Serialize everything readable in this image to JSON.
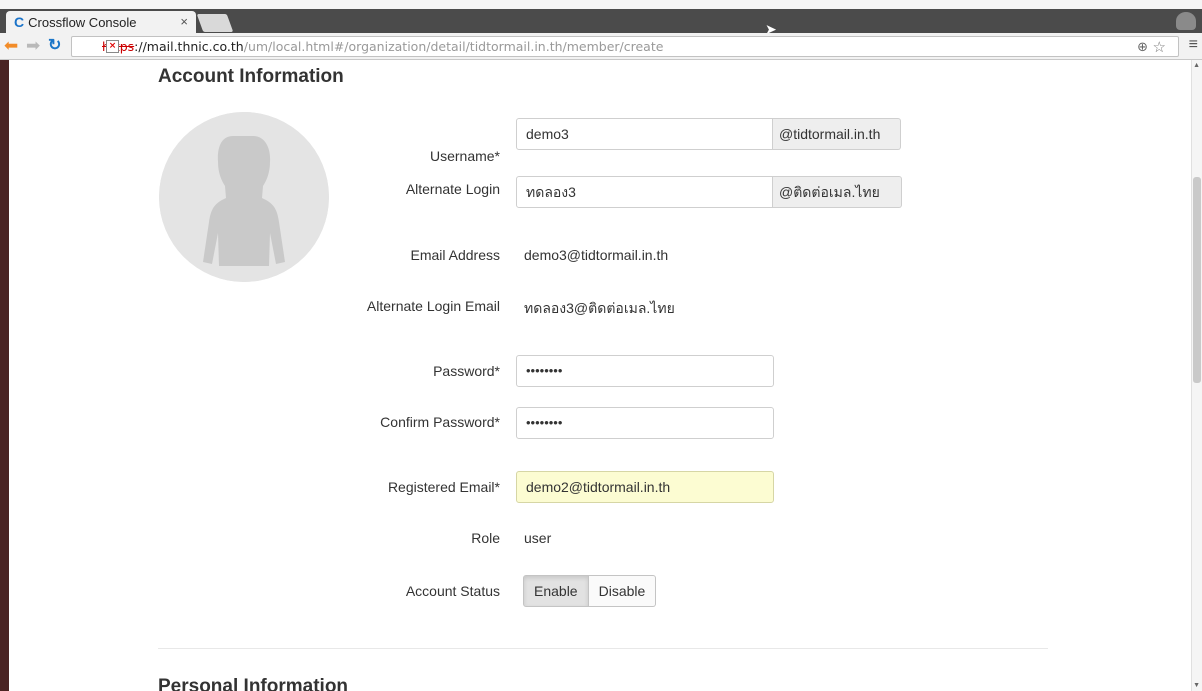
{
  "browser": {
    "tab_title": "Crossflow Console",
    "tab_close": "×",
    "url_scheme": "https",
    "url_host": "://mail.thnic.co.th",
    "url_path": "/um/local.html#/organization/detail/tidtormail.in.th/member/create"
  },
  "account": {
    "section_title": "Account Information",
    "username_label": "Username*",
    "username_value": "demo3",
    "username_domain": "@tidtormail.in.th",
    "alt_login_label": "Alternate Login",
    "alt_login_value": "ทดลอง3",
    "alt_login_domain": "@ติดต่อเมล.ไทย",
    "email_label": "Email Address",
    "email_value": "demo3@tidtormail.in.th",
    "alt_email_label": "Alternate Login Email",
    "alt_email_value": "ทดลอง3@ติดต่อเมล.ไทย",
    "password_label": "Password*",
    "password_value": "••••••••",
    "confirm_label": "Confirm Password*",
    "confirm_value": "••••••••",
    "registered_label": "Registered Email*",
    "registered_value": "demo2@tidtormail.in.th",
    "role_label": "Role",
    "role_value": "user",
    "status_label": "Account Status",
    "status_enable": "Enable",
    "status_disable": "Disable",
    "status_selected": "Enable"
  },
  "personal": {
    "section_title": "Personal Information"
  },
  "colors": {
    "tab_bar": "#4b4b4b",
    "left_bar": "#4a2323",
    "autofill": "#fcfcd2"
  }
}
